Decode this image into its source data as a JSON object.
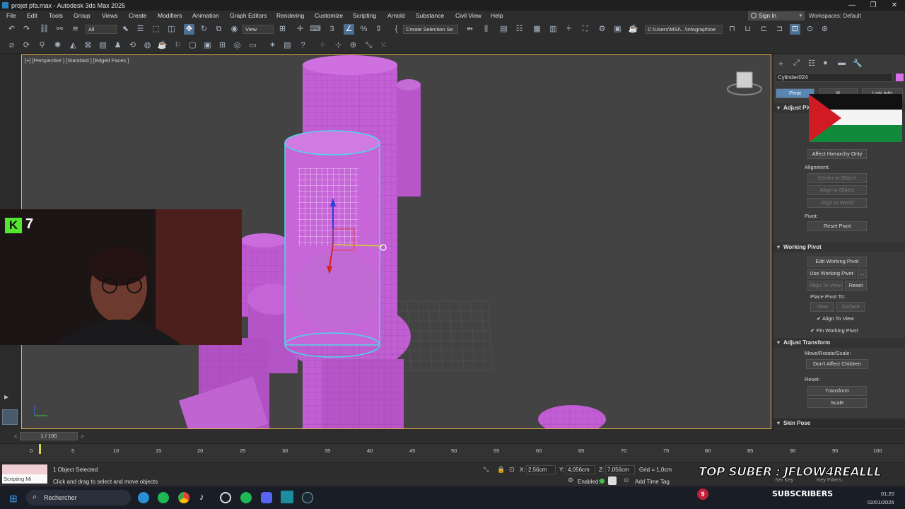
{
  "window": {
    "title": "projet pfa.max - Autodesk 3ds Max 2025",
    "controls": [
      "—",
      "❐",
      "✕"
    ]
  },
  "menu": [
    "File",
    "Edit",
    "Tools",
    "Group",
    "Views",
    "Create",
    "Modifiers",
    "Animation",
    "Graph Editors",
    "Rendering",
    "Customize",
    "Scripting",
    "Arnold",
    "Substance",
    "Civil View",
    "Help"
  ],
  "account": {
    "signin_label": "Sign In",
    "workspaces_label": "Workspaces:",
    "workspace_value": "Default"
  },
  "toolbar": {
    "selection_filter": "All",
    "ref_coord": "View",
    "named_selection": "Create Selection Se",
    "project_path": "C:\\Users\\MSI\\...\\infographioe"
  },
  "viewport": {
    "label": "[+] [Perspective ] [Standard ] [Edged Faces ]",
    "vp_badge": "7"
  },
  "command_panel": {
    "object_name": "Cylinder024",
    "object_color": "#d86ee8",
    "tabs": [
      "Pivot",
      "IK",
      "Link Info"
    ],
    "adjust_pivot": {
      "title": "Adjust Pivot",
      "affect_hierarchy": "Affect Hierarchy Only",
      "alignment_label": "Alignment:",
      "center_to_object": "Center to Object",
      "align_to_object": "Align to Object",
      "align_to_world": "Align to World",
      "pivot_label": "Pivot:",
      "reset_pivot": "Reset Pivot"
    },
    "working_pivot": {
      "title": "Working Pivot",
      "edit_working_pivot": "Edit Working Pivot",
      "use_working_pivot": "Use Working Pivot",
      "ellipsis": "...",
      "align_to_view": "Align To View",
      "reset": "Reset",
      "place_pivot_to": "Place Pivot To:",
      "view": "View",
      "surface": "Surface",
      "align_to_view_check": "Align To View",
      "pin_working_pivot": "Pin Working Pivot"
    },
    "adjust_transform": {
      "title": "Adjust Transform",
      "move_rotate_scale": "Move/Rotate/Scale:",
      "dont_affect_children": "Don't Affect Children",
      "reset_label": "Reset:",
      "transform": "Transform",
      "scale": "Scale"
    },
    "skin_pose": {
      "title": "Skin Pose"
    }
  },
  "time_slider": {
    "frame": "1 / 100",
    "prev": "<",
    "next": ">"
  },
  "trackbar": {
    "ticks": [
      "0",
      "5",
      "10",
      "15",
      "20",
      "25",
      "30",
      "35",
      "40",
      "45",
      "50",
      "55",
      "60",
      "65",
      "70",
      "75",
      "80",
      "85",
      "90",
      "95",
      "100"
    ]
  },
  "status": {
    "script_label": "Scripting Mi",
    "selection_status": "1 Object Selected",
    "prompt": "Click and drag to select and move objects",
    "x_label": "X:",
    "x_value": "2,56cm",
    "y_label": "Y:",
    "y_value": "4,056cm",
    "z_label": "Z:",
    "z_value": "7,056cm",
    "grid": "Grid = 1,0cm",
    "enabled": "Enabled:",
    "add_time_tag": "Add Time Tag",
    "set_key": "Set Key",
    "key_filters": "Key Filters..."
  },
  "stream_overlay": {
    "top_suber": "TOP SUBER : JFLOW4REALLL",
    "subscribers_count": "9",
    "subscribers_label": "SUBSCRIBERS"
  },
  "taskbar": {
    "search_placeholder": "Rechercher",
    "time": "01:20",
    "date": "02/01/2025"
  }
}
